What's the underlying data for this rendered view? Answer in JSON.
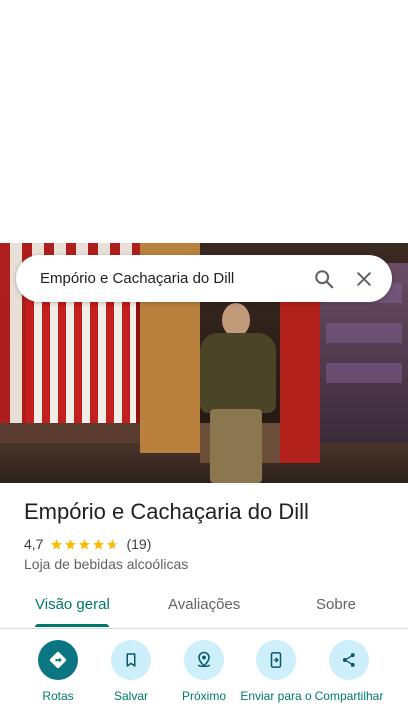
{
  "search": {
    "query": "Empório e Cachaçaria do Dill"
  },
  "place": {
    "name": "Empório e Cachaçaria do Dill",
    "rating": "4,7",
    "rating_value": 4.7,
    "review_count": "(19)",
    "category": "Loja de bebidas alcoólicas"
  },
  "tabs": [
    {
      "label": "Visão geral",
      "active": true
    },
    {
      "label": "Avaliações",
      "active": false
    },
    {
      "label": "Sobre",
      "active": false
    }
  ],
  "actions": [
    {
      "label": "Rotas",
      "icon": "directions-icon"
    },
    {
      "label": "Salvar",
      "icon": "bookmark-icon"
    },
    {
      "label": "Próximo",
      "icon": "nearby-icon"
    },
    {
      "label": "Enviar para o",
      "icon": "send-to-phone-icon"
    },
    {
      "label": "Compartilhar",
      "icon": "share-icon"
    }
  ],
  "colors": {
    "accent": "#00796b",
    "star": "#fbbc04",
    "action_bg": "#cdeffb",
    "primary_action_bg": "#0b7582"
  }
}
